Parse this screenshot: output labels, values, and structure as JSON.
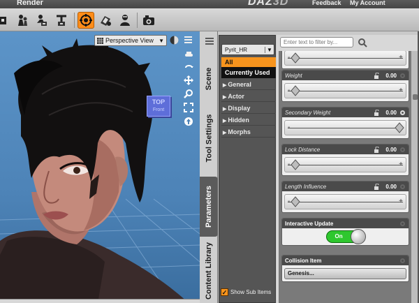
{
  "menubar": {
    "render_label": "Render",
    "logo_main": "DAZ",
    "logo_accent": "3D",
    "feedback_label": "Feedback",
    "account_label": "My Account"
  },
  "toolbar": {
    "tools": [
      "figure-add-icon",
      "figure-tool-icon",
      "node-icon",
      "target-tool-icon",
      "pose-tool-icon",
      "morph-tool-icon",
      "camera-render-icon"
    ],
    "active_tool": "target-tool-icon",
    "accent": "#ff8d1a"
  },
  "viewport": {
    "view_label": "Perspective View",
    "cube_label": "TOP",
    "cube_sub": "Front",
    "background": "#5c94c8"
  },
  "panel": {
    "tabs": [
      "Scene",
      "Tool Settings",
      "Parameters",
      "Content Library"
    ],
    "active_tab": "Parameters",
    "node_name": "Pyrit_HR",
    "categories": {
      "all": "All",
      "current": "Currently Used",
      "groups": [
        "General",
        "Actor",
        "Display",
        "Hidden",
        "Morphs"
      ]
    },
    "show_sub_items": "Show Sub Items",
    "filter_placeholder": "Enter text to filter by...",
    "accent": "#f7941d"
  },
  "properties": {
    "top_partial": {
      "value_fraction": 0.0
    },
    "weight": {
      "label": "Weight",
      "value": "0.00",
      "fraction": 0.0
    },
    "secondary_weight": {
      "label": "Secondary Weight",
      "value": "0.00",
      "fraction": 1.0
    },
    "lock_distance": {
      "label": "Lock Distance",
      "value": "0.00",
      "fraction": 0.0
    },
    "length_influence": {
      "label": "Length Influence",
      "value": "0.00",
      "fraction": 0.0
    },
    "interactive_update": {
      "label": "Interactive Update",
      "state": "On"
    },
    "collision_item": {
      "label": "Collision Item",
      "button": "Genesis..."
    },
    "toggle_color": "#2ec72e"
  }
}
